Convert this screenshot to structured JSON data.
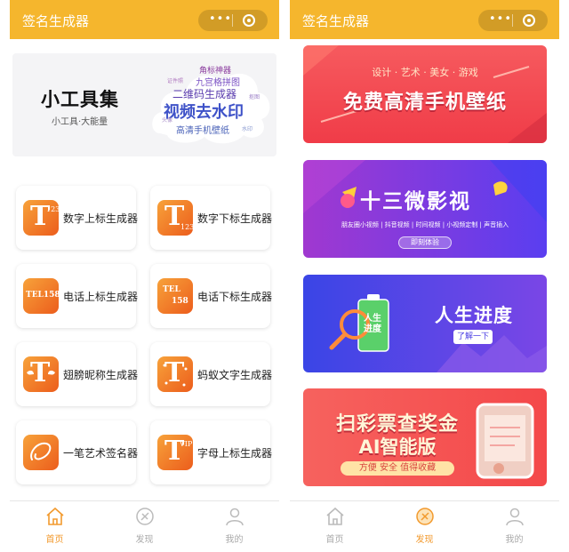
{
  "left": {
    "title": "签名生成器",
    "hero": {
      "title": "小工具集",
      "subtitle": "小工具·大能量",
      "cloud": [
        "角标神器",
        "九宫格拼图",
        "二维码生成器",
        "视频去水印",
        "高清手机壁纸",
        "证件照",
        "抠图",
        "水印",
        "头像"
      ]
    },
    "tools": [
      {
        "label": "数字上标生成器",
        "sup": "123"
      },
      {
        "label": "数字下标生成器",
        "sub": "123"
      },
      {
        "label": "电话上标生成器",
        "text": "TEL158"
      },
      {
        "label": "电话下标生成器",
        "text_a": "TEL",
        "text_b": "158"
      },
      {
        "label": "翅膀昵称生成器"
      },
      {
        "label": "蚂蚁文字生成器"
      },
      {
        "label": "一笔艺术签名器"
      },
      {
        "label": "字母上标生成器",
        "sup": "VIP"
      }
    ],
    "tabs": [
      {
        "label": "首页",
        "active": true
      },
      {
        "label": "发现",
        "active": false
      },
      {
        "label": "我的",
        "active": false
      }
    ]
  },
  "right": {
    "title": "签名生成器",
    "banners": {
      "wallpaper": {
        "tag": "设计 · 艺术 · 美女 · 游戏",
        "main": "免费高清手机壁纸"
      },
      "video": {
        "logo": "十三微影视",
        "desc": "朋友圈小视频 | 抖音视频 | 时间视频 | 小视频定制 | 声音插入",
        "button": "即刻体验"
      },
      "progress": {
        "badge": "人生进度",
        "title": "人生进度",
        "button": "了解一下"
      },
      "lottery": {
        "main": "扫彩票查奖金",
        "sub": "AI智能版",
        "pill": "方便 安全 值得收藏"
      }
    },
    "tabs": [
      {
        "label": "首页",
        "active": false
      },
      {
        "label": "发现",
        "active": true
      },
      {
        "label": "我的",
        "active": false
      }
    ]
  },
  "capsule": {
    "more": "•••"
  },
  "colors": {
    "header": "#f5b62d",
    "accent": "#f29a2e",
    "icon_gradient_start": "#f7a23a",
    "icon_gradient_end": "#ec5d1c"
  }
}
